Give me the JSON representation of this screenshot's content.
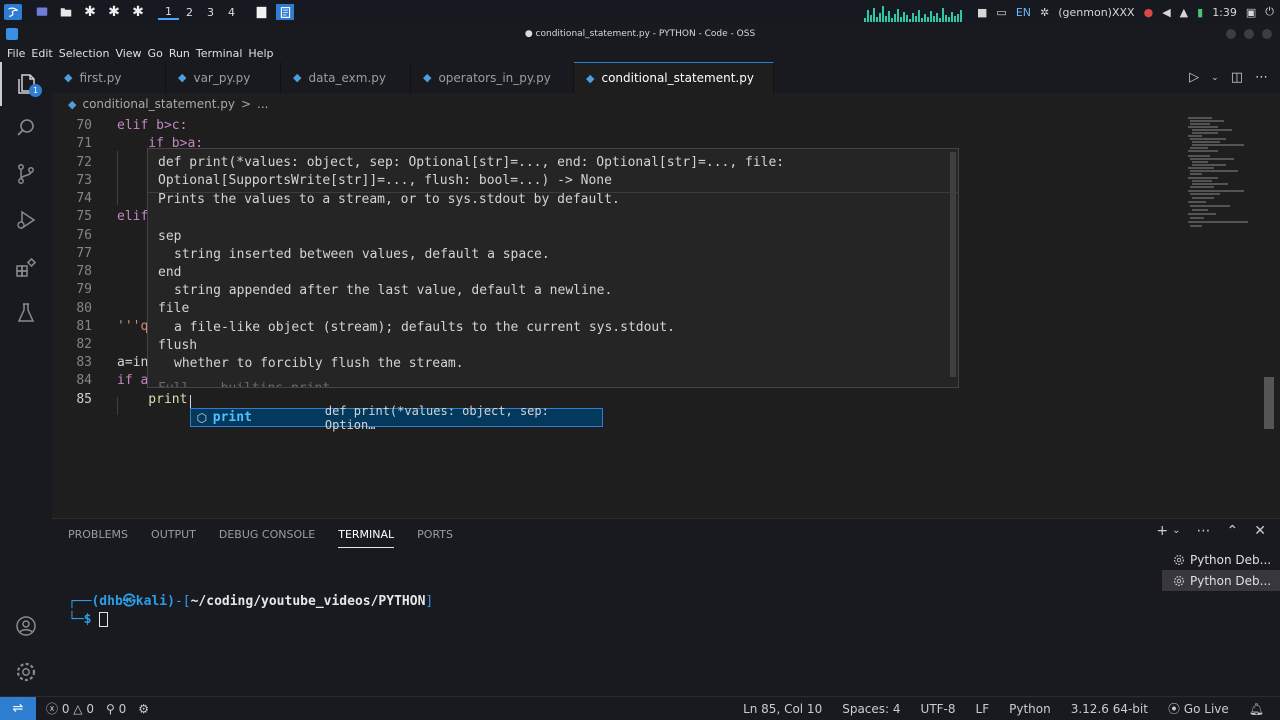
{
  "system_bar": {
    "workspaces": [
      "1",
      "2",
      "3",
      "4"
    ],
    "active_workspace": "1",
    "language": "EN",
    "genmon": "(genmon)XXX",
    "clock": "1:39"
  },
  "window": {
    "title": "conditional_statement.py - PYTHON - Code - OSS"
  },
  "menu": [
    "File",
    "Edit",
    "Selection",
    "View",
    "Go",
    "Run",
    "Terminal",
    "Help"
  ],
  "activity_bar": {
    "explorer_badge": "1"
  },
  "tabs": [
    {
      "label": "first.py"
    },
    {
      "label": "var_py.py"
    },
    {
      "label": "data_exm.py"
    },
    {
      "label": "operators_in_py.py"
    },
    {
      "label": "conditional_statement.py"
    }
  ],
  "breadcrumb": {
    "file": "conditional_statement.py",
    "separator": ">",
    "more": "..."
  },
  "editor": {
    "lines": [
      {
        "num": "70",
        "text": "elif b>c:"
      },
      {
        "num": "71",
        "text": "    if b>a:"
      },
      {
        "num": "72",
        "text": ""
      },
      {
        "num": "73",
        "text": ""
      },
      {
        "num": "74",
        "text": ""
      },
      {
        "num": "75",
        "text": "elif"
      },
      {
        "num": "76",
        "text": ""
      },
      {
        "num": "77",
        "text": ""
      },
      {
        "num": "78",
        "text": ""
      },
      {
        "num": "79",
        "text": ""
      },
      {
        "num": "80",
        "text": ""
      },
      {
        "num": "81",
        "text": "'''q"
      },
      {
        "num": "82",
        "text": ""
      },
      {
        "num": "83",
        "text": "a=in"
      },
      {
        "num": "84",
        "text": "if a"
      },
      {
        "num": "85",
        "text": "    print"
      }
    ]
  },
  "hover": {
    "sig1": "def print(*values: object, sep: Optional[str]=..., end: Optional[str]=..., file:",
    "sig2": "Optional[SupportsWrite[str]]=..., flush: bool=...) -> None",
    "desc": "Prints the values to a stream, or to sys.stdout by default.",
    "params": [
      {
        "name": "sep",
        "desc": "string inserted between values, default a space."
      },
      {
        "name": "end",
        "desc": "string appended after the last value, default a newline."
      },
      {
        "name": "file",
        "desc": "a file-like object (stream); defaults to the current sys.stdout."
      },
      {
        "name": "flush",
        "desc": "whether to forcibly flush the stream."
      }
    ],
    "footer": "Full... builtins.print"
  },
  "suggest": {
    "label": "print",
    "detail": "def print(*values: object, sep: Option…"
  },
  "panel": {
    "tabs": [
      "PROBLEMS",
      "OUTPUT",
      "DEBUG CONSOLE",
      "TERMINAL",
      "PORTS"
    ],
    "active_tab": "TERMINAL",
    "prompt_user": "(dhb㉿kali)",
    "prompt_path": "~/coding/youtube_videos/PYTHON",
    "prompt_symbol": "$",
    "terminals": [
      "Python Deb...",
      "Python Deb..."
    ]
  },
  "status_bar": {
    "errors": "0",
    "warnings": "0",
    "ports": "0",
    "position": "Ln 85, Col 10",
    "spaces": "Spaces: 4",
    "encoding": "UTF-8",
    "eol": "LF",
    "language": "Python",
    "interpreter": "3.12.6 64-bit",
    "golive": "Go Live"
  },
  "colors": {
    "accent": "#2f7dd1",
    "keyword": "#c586c0",
    "suggest_label": "#4fc1ff"
  }
}
